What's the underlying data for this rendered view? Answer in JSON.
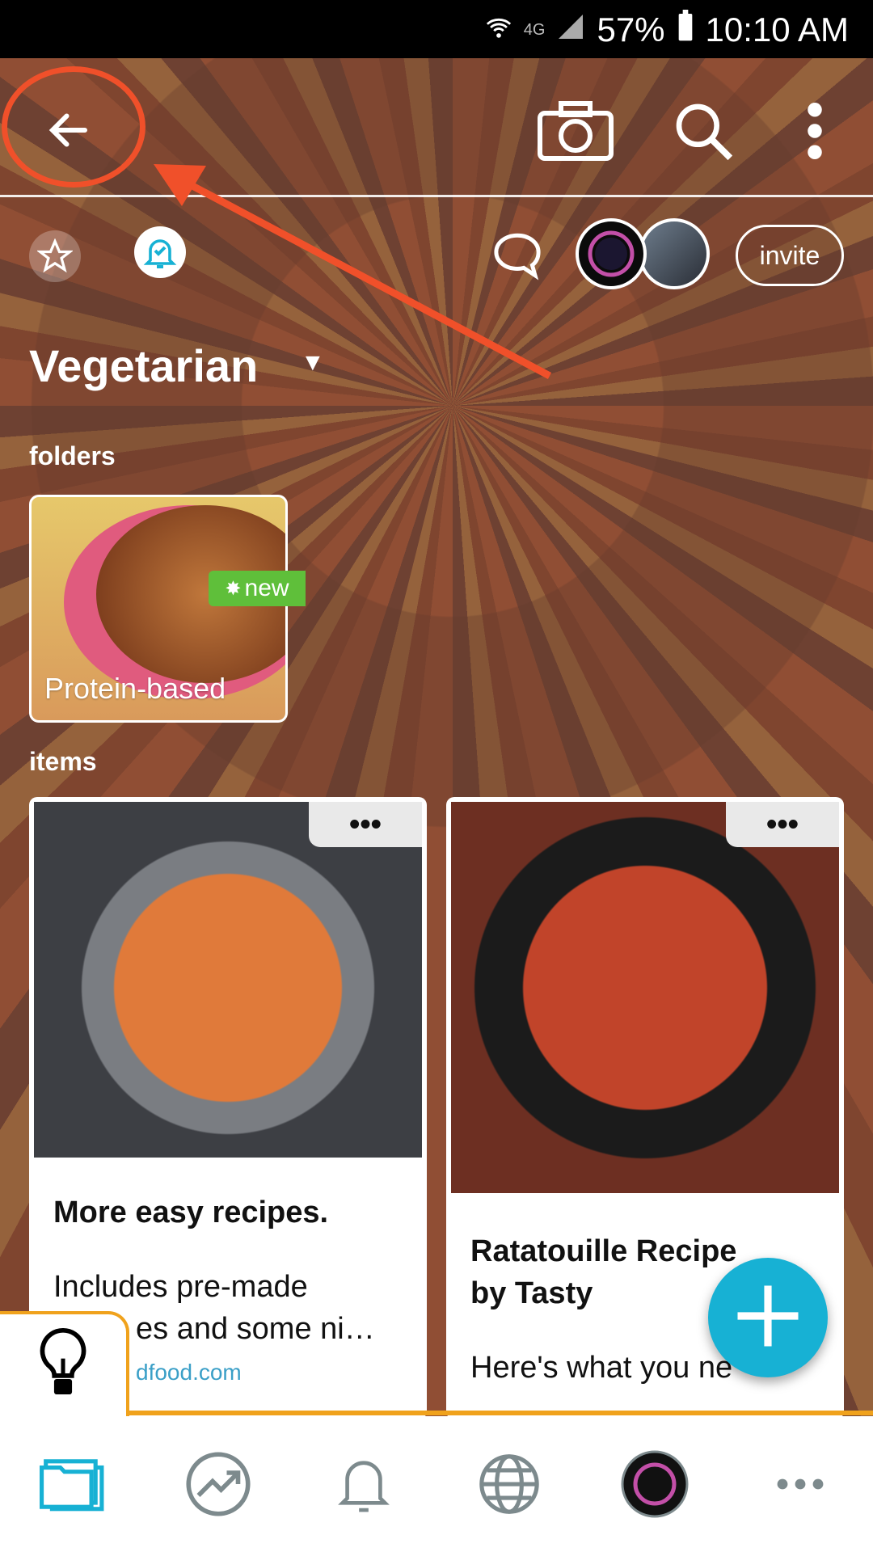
{
  "status_bar": {
    "network": "4G",
    "battery": "57%",
    "time": "10:10 AM"
  },
  "header": {
    "collection_title": "Vegetarian",
    "invite_label": "invite"
  },
  "folders": {
    "section_label": "folders",
    "items": [
      {
        "label": "Protein-based",
        "badge": "new"
      }
    ]
  },
  "items": {
    "section_label": "items",
    "cards": [
      {
        "title": "More easy recipes.",
        "description_line1": "Includes pre-made",
        "description_line2": "es and some ni…",
        "source": "dfood.com"
      },
      {
        "title_line1": "Ratatouille Recipe",
        "title_line2": "by Tasty",
        "description_line1": "Here's what you ne"
      }
    ]
  },
  "colors": {
    "accent": "#17b1d4",
    "annotation": "#f0502a",
    "tip_border": "#f0a21c",
    "new_badge": "#5fbf3a"
  },
  "icons": {
    "back": "arrow-left-icon",
    "camera": "camera-icon",
    "search": "search-icon",
    "more": "more-vertical-icon",
    "star": "star-icon",
    "bell": "bell-check-icon",
    "chat": "chat-bubble-icon",
    "fab": "plus-icon",
    "tip": "lightbulb-icon",
    "nav": [
      "folders-icon",
      "trending-icon",
      "bell-icon",
      "globe-icon",
      "profile-avatar",
      "more-horizontal-icon"
    ]
  }
}
